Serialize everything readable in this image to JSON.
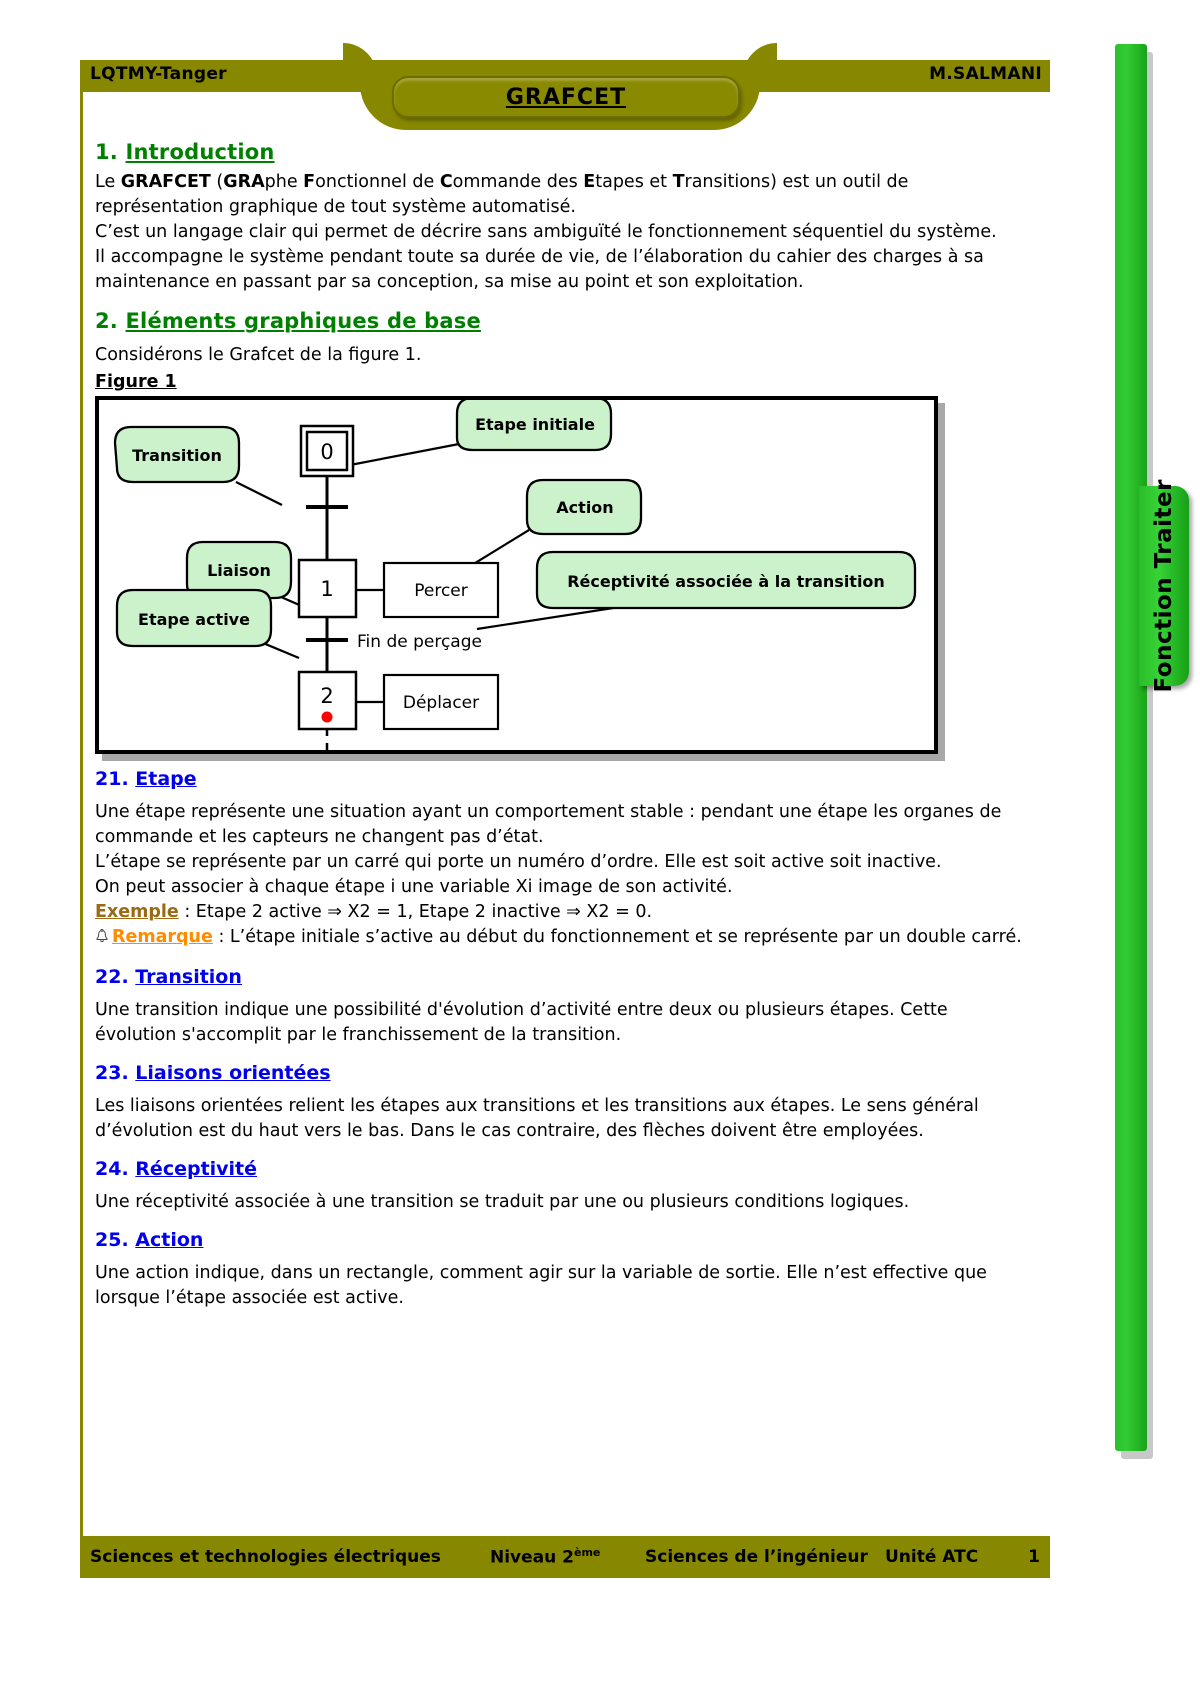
{
  "header": {
    "left": "LQTMY-Tanger",
    "right": "M.SALMANI",
    "title": "GRAFCET"
  },
  "side_tab": {
    "label": "Fonction Traiter"
  },
  "footer": {
    "col1": "Sciences et technologies électriques",
    "col2_pre": "Niveau 2",
    "col2_sup": "ème",
    "col3": "Sciences de l’ingénieur",
    "col4": "Unité ATC",
    "page": "1"
  },
  "sections": {
    "s1": {
      "num": "1.",
      "title": "Introduction",
      "p1_prefix": "Le ",
      "p1_b1": "GRAFCET",
      "p1_mid1": " (",
      "p1_b2": "GRA",
      "p1_t1": "phe ",
      "p1_b3": "F",
      "p1_t2": "onctionnel de ",
      "p1_b4": "C",
      "p1_t3": "ommande des ",
      "p1_b5": "E",
      "p1_t4": "tapes et ",
      "p1_b6": "T",
      "p1_t5": "ransitions) est un outil de représentation graphique de tout système automatisé.",
      "p2": "C’est un langage clair qui permet de décrire sans ambiguïté le fonctionnement séquentiel du système.",
      "p3": "Il accompagne le système pendant toute sa durée de vie, de l’élaboration du cahier des charges à sa maintenance en passant par sa conception, sa mise au point et son exploitation."
    },
    "s2": {
      "num": "2.",
      "title": "Eléments graphiques de base",
      "p1": "Considérons le Grafcet de la figure 1.",
      "figure_label": "Figure 1"
    },
    "s21": {
      "num": "21.",
      "title": "Etape",
      "p1": "Une étape représente une situation ayant un comportement stable : pendant une étape les organes de commande et les capteurs ne changent pas d’état.",
      "p2": "L’étape se représente par un carré qui porte un numéro d’ordre. Elle est soit active soit inactive.",
      "p3": "On peut associer à chaque étape i une variable Xi image de son activité.",
      "exemple_label": "Exemple",
      "exemple_text": " : Etape 2 active ⇒ X2 = 1, Etape 2 inactive ⇒ X2 = 0.",
      "remarque_label": "Remarque",
      "remarque_text": " : L’étape initiale s’active au début du fonctionnement et se représente par un double carré."
    },
    "s22": {
      "num": "22.",
      "title": "Transition",
      "p1": "Une transition indique une possibilité d'évolution d’activité entre deux ou plusieurs étapes. Cette évolution s'accomplit par le franchissement de la transition."
    },
    "s23": {
      "num": "23.",
      "title": "Liaisons orientées",
      "p1": "Les liaisons orientées relient les étapes aux transitions et les transitions aux étapes. Le sens général d’évolution est du haut vers le bas. Dans le cas contraire, des flèches doivent être employées."
    },
    "s24": {
      "num": "24.",
      "title": "Réceptivité",
      "p1": "Une réceptivité associée à une transition se traduit par une ou plusieurs conditions logiques."
    },
    "s25": {
      "num": "25.",
      "title": "Action",
      "p1": "Une action indique, dans un rectangle, comment agir sur la variable de sortie. Elle n’est effective que lorsque l’étape associée est active."
    }
  },
  "figure": {
    "steps": [
      {
        "id": "step0",
        "label": "0",
        "type": "initial"
      },
      {
        "id": "step1",
        "label": "1",
        "type": "normal"
      },
      {
        "id": "step2",
        "label": "2",
        "type": "active"
      }
    ],
    "actions": [
      {
        "id": "action1",
        "label": "Percer"
      },
      {
        "id": "action2",
        "label": "Déplacer"
      }
    ],
    "receptivities": [
      {
        "id": "recept1",
        "label": "Fin de perçage"
      }
    ],
    "callouts": [
      {
        "id": "c-transition",
        "label": "Transition"
      },
      {
        "id": "c-etape-initiale",
        "label": "Etape initiale"
      },
      {
        "id": "c-action",
        "label": "Action"
      },
      {
        "id": "c-liaison",
        "label": "Liaison"
      },
      {
        "id": "c-receptivite",
        "label": "Réceptivité associée à la transition"
      },
      {
        "id": "c-etape-active",
        "label": "Etape active"
      }
    ],
    "colors": {
      "callout_fill": "#ccf2cc",
      "active_dot": "#ff0000",
      "stroke": "#000000"
    }
  },
  "colors": {
    "header_olive": "#878700",
    "rail_green": "#33cc33",
    "heading_green": "#008000",
    "heading_blue": "#0000ee",
    "exemple_brown": "#9a6b14",
    "remarque_orange": "#ff8c00"
  }
}
